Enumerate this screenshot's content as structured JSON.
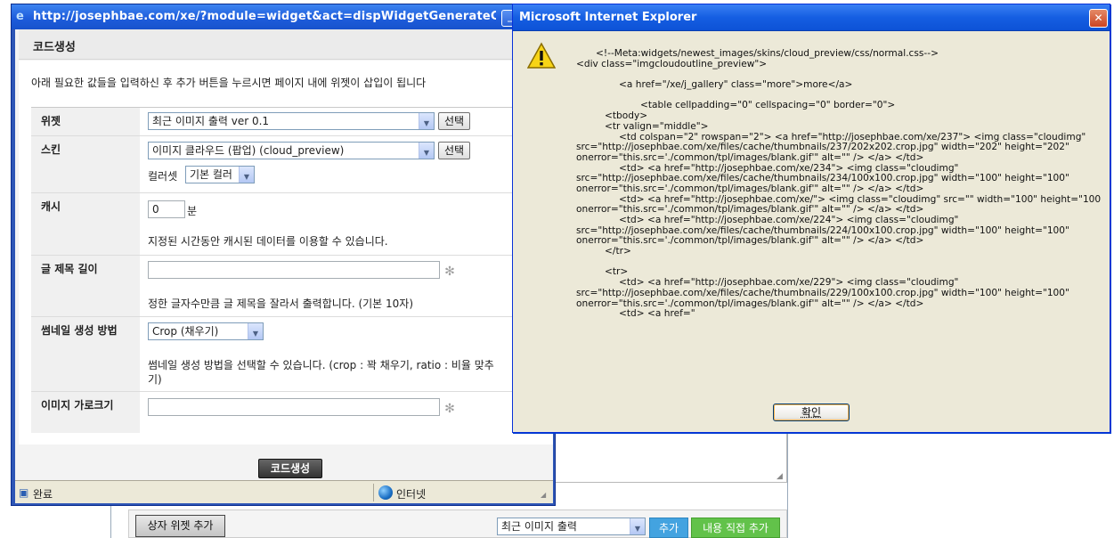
{
  "background": {
    "box_widget_button": "상자 위젯 추가",
    "widget_select": "최근 이미지 출력",
    "add_button": "추가",
    "direct_add_button": "내용 직접 추가"
  },
  "popup": {
    "url": "http://josephbae.com/xe/?module=widget&act=dispWidgetGenerateC...",
    "header_title": "코드생성",
    "description": "아래 필요한 값들을 입력하신 후 추가 버튼을 누르시면 페이지 내에 위젯이 삽입이 됩니다",
    "rows": {
      "widget": {
        "label": "위젯",
        "value": "최근 이미지 출력 ver 0.1",
        "button": "선택"
      },
      "skin": {
        "label": "스킨",
        "value": "이미지 클라우드 (팝업) (cloud_preview)",
        "button": "선택",
        "colorset_label": "컬러셋",
        "colorset_value": "기본 컬러"
      },
      "cache": {
        "label": "캐시",
        "value": "0",
        "unit": "분",
        "help": "지정된 시간동안 캐시된 데이터를 이용할 수 있습니다."
      },
      "title_length": {
        "label": "글 제목 길이",
        "value": "",
        "help": "정한 글자수만큼 글 제목을 잘라서 출력합니다. (기본 10자)"
      },
      "thumbnail_method": {
        "label": "썸네일 생성 방법",
        "value": "Crop (채우기)",
        "help": "썸네일 생성 방법을 선택할 수 있습니다. (crop : 꽉 채우기, ratio : 비율 맞추기)"
      },
      "image_width": {
        "label": "이미지 가로크기",
        "value": ""
      }
    },
    "generate_button": "코드생성",
    "status": {
      "text": "완료",
      "zone": "인터넷"
    }
  },
  "dialog": {
    "title": "Microsoft Internet Explorer",
    "message_lines": [
      "<!--Meta:widgets/newest_images/skins/cloud_preview/css/normal.css-->",
      "<div class=\"imgcloudoutline_preview\">",
      "",
      "        <a href=\"/xe/j_gallery\" class=\"more\">more</a>",
      "",
      "            <table cellpadding=\"0\" cellspacing=\"0\" border=\"0\">",
      "    <tbody>",
      "    <tr valign=\"middle\">",
      "        <td colspan=\"2\" rowspan=\"2\"> <a href=\"http://josephbae.com/xe/237\"> <img class=\"cloudimg\"",
      "src=\"http://josephbae.com/xe/files/cache/thumbnails/237/202x202.crop.jpg\" width=\"202\" height=\"202\"",
      "onerror=\"this.src='./common/tpl/images/blank.gif'\" alt=\"\" /> </a> </td>",
      "        <td> <a href=\"http://josephbae.com/xe/234\"> <img class=\"cloudimg\"",
      "src=\"http://josephbae.com/xe/files/cache/thumbnails/234/100x100.crop.jpg\" width=\"100\" height=\"100\"",
      "onerror=\"this.src='./common/tpl/images/blank.gif'\" alt=\"\" /> </a> </td>",
      "        <td> <a href=\"http://josephbae.com/xe/\"> <img class=\"cloudimg\" src=\"\" width=\"100\" height=\"100\"",
      "onerror=\"this.src='./common/tpl/images/blank.gif'\" alt=\"\" /> </a> </td>",
      "        <td> <a href=\"http://josephbae.com/xe/224\"> <img class=\"cloudimg\"",
      "src=\"http://josephbae.com/xe/files/cache/thumbnails/224/100x100.crop.jpg\" width=\"100\" height=\"100\"",
      "onerror=\"this.src='./common/tpl/images/blank.gif'\" alt=\"\" /> </a> </td>",
      "    </tr>",
      "",
      "    <tr>",
      "        <td> <a href=\"http://josephbae.com/xe/229\"> <img class=\"cloudimg\"",
      "src=\"http://josephbae.com/xe/files/cache/thumbnails/229/100x100.crop.jpg\" width=\"100\" height=\"100\"",
      "onerror=\"this.src='./common/tpl/images/blank.gif'\" alt=\"\" /> </a> </td>",
      "        <td> <a href=\""
    ],
    "ok_button": "확인",
    "icon": "warning-icon"
  }
}
